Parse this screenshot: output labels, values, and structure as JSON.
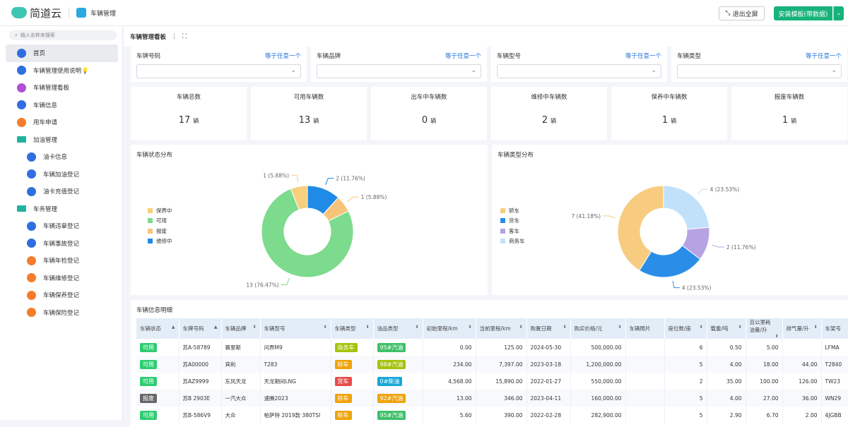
{
  "header": {
    "brand": "简道云",
    "app": "车辆管理",
    "exit_full": "退出全屏",
    "install": "安装模板(带数据)"
  },
  "sidebar": {
    "search_placeholder": "输入名称来搜索",
    "items": [
      {
        "label": "首页",
        "color": "#2f6fe0",
        "type": "page"
      },
      {
        "label": "车辆管理使用说明💡",
        "color": "#2f6fe0",
        "type": "page"
      },
      {
        "label": "车辆管理看板",
        "color": "#b14fd8",
        "type": "page"
      },
      {
        "label": "车辆信息",
        "color": "#2f6fe0",
        "type": "page"
      },
      {
        "label": "用车申请",
        "color": "#f57c2b",
        "type": "page"
      },
      {
        "label": "加油管理",
        "type": "folder"
      },
      {
        "label": "油卡信息",
        "color": "#2f6fe0",
        "type": "sub"
      },
      {
        "label": "车辆加油登记",
        "color": "#2f6fe0",
        "type": "sub"
      },
      {
        "label": "油卡充值登记",
        "color": "#2f6fe0",
        "type": "sub"
      },
      {
        "label": "车务管理",
        "type": "folder"
      },
      {
        "label": "车辆违章登记",
        "color": "#2f6fe0",
        "type": "sub"
      },
      {
        "label": "车辆事故登记",
        "color": "#2f6fe0",
        "type": "sub"
      },
      {
        "label": "车辆年检登记",
        "color": "#f57c2b",
        "type": "sub"
      },
      {
        "label": "车辆维修登记",
        "color": "#f57c2b",
        "type": "sub"
      },
      {
        "label": "车辆保养登记",
        "color": "#f57c2b",
        "type": "sub"
      },
      {
        "label": "车辆保险登记",
        "color": "#f57c2b",
        "type": "sub"
      }
    ]
  },
  "dashboard": {
    "title": "车辆管理看板"
  },
  "filters": [
    {
      "label": "车牌号码",
      "op": "等于任意一个"
    },
    {
      "label": "车辆品牌",
      "op": "等于任意一个"
    },
    {
      "label": "车辆型号",
      "op": "等于任意一个"
    },
    {
      "label": "车辆类型",
      "op": "等于任意一个"
    }
  ],
  "stats": [
    {
      "label": "车辆总数",
      "value": "17",
      "unit": "辆"
    },
    {
      "label": "可用车辆数",
      "value": "13",
      "unit": "辆"
    },
    {
      "label": "出车中车辆数",
      "value": "0",
      "unit": "辆"
    },
    {
      "label": "维修中车辆数",
      "value": "2",
      "unit": "辆"
    },
    {
      "label": "保养中车辆数",
      "value": "1",
      "unit": "辆"
    },
    {
      "label": "报废车辆数",
      "value": "1",
      "unit": "辆"
    }
  ],
  "chart_data": [
    {
      "type": "pie",
      "title": "车辆状态分布",
      "legend": "left",
      "slices": [
        {
          "name": "维修中",
          "value": 2,
          "label": "2 (11.76%)",
          "color": "#1f8be6"
        },
        {
          "name": "报废",
          "value": 1,
          "label": "1 (5.88%)",
          "color": "#f7c47c"
        },
        {
          "name": "可用",
          "value": 13,
          "label": "13 (76.47%)",
          "color": "#7cdb8c"
        },
        {
          "name": "保养中",
          "value": 1,
          "label": "1 (5.88%)",
          "color": "#f7cf7d"
        }
      ],
      "legend_order": [
        "保养中",
        "可用",
        "报废",
        "维修中"
      ]
    },
    {
      "type": "pie",
      "title": "车辆类型分布",
      "legend": "left",
      "slices": [
        {
          "name": "商务车",
          "value": 4,
          "label": "4 (23.53%)",
          "color": "#c1e1fb"
        },
        {
          "name": "客车",
          "value": 2,
          "label": "2 (11.76%)",
          "color": "#b5a3e3"
        },
        {
          "name": "货车",
          "value": 4,
          "label": "4 (23.53%)",
          "color": "#2a8ee8"
        },
        {
          "name": "轿车",
          "value": 7,
          "label": "7 (41.18%)",
          "color": "#f8cc80"
        }
      ],
      "legend_order": [
        "轿车",
        "货车",
        "客车",
        "商务车"
      ]
    }
  ],
  "table": {
    "title": "车辆信息明细",
    "columns": [
      "车辆状态",
      "车牌号码",
      "车辆品牌",
      "车辆型号",
      "车辆类型",
      "油品类型",
      "初始里程/km",
      "当前里程/km",
      "购置日期",
      "购买价格/元",
      "车辆照片",
      "座位数/座",
      "载重/吨",
      "百公里耗油量/升",
      "排气量/升",
      "车架号"
    ],
    "rows": [
      [
        "可用",
        "苏A-58789",
        "赛里斯",
        "问界M9",
        "商务车",
        "95#汽油",
        "0.00",
        "125.00",
        "2024-05-30",
        "500,000.00",
        "",
        "6",
        "0.50",
        "5.00",
        "",
        "LFMA"
      ],
      [
        "可用",
        "苏A00000",
        "宾利",
        "T283",
        "轿车",
        "98#汽油",
        "234.00",
        "7,397.00",
        "2023-03-18",
        "1,200,000.00",
        "",
        "5",
        "4.00",
        "18.00",
        "44.00",
        "T2840"
      ],
      [
        "可用",
        "苏AZ9999",
        "东风天龙",
        "天龙期间LNG",
        "货车",
        "0#柴油",
        "4,568.00",
        "15,890.00",
        "2022-01-27",
        "550,000.00",
        "",
        "2",
        "35.00",
        "100.00",
        "126.00",
        "TW23"
      ],
      [
        "报废",
        "苏B 2903E",
        "一汽大众",
        "速腾2023",
        "轿车",
        "92#汽油",
        "13.00",
        "346.00",
        "2023-04-11",
        "160,000.00",
        "",
        "5",
        "4.00",
        "27.00",
        "36.00",
        "WN29"
      ],
      [
        "可用",
        "苏B-586V9",
        "大众",
        "帕萨特 2019款 380TSI",
        "轿车",
        "95#汽油",
        "5.60",
        "390.00",
        "2022-02-28",
        "282,900.00",
        "",
        "5",
        "2.90",
        "6.70",
        "2.00",
        "4JGBB"
      ]
    ],
    "tag_colors": {
      "可用": "#2ecc71",
      "报废": "#666666",
      "商务车": "#a5c30c",
      "轿车": "#f0a30a",
      "货车": "#e84c4c",
      "95#汽油": "#3fc06a",
      "98#汽油": "#a5c30c",
      "0#柴油": "#17a8d8",
      "92#汽油": "#f0a30a"
    }
  }
}
